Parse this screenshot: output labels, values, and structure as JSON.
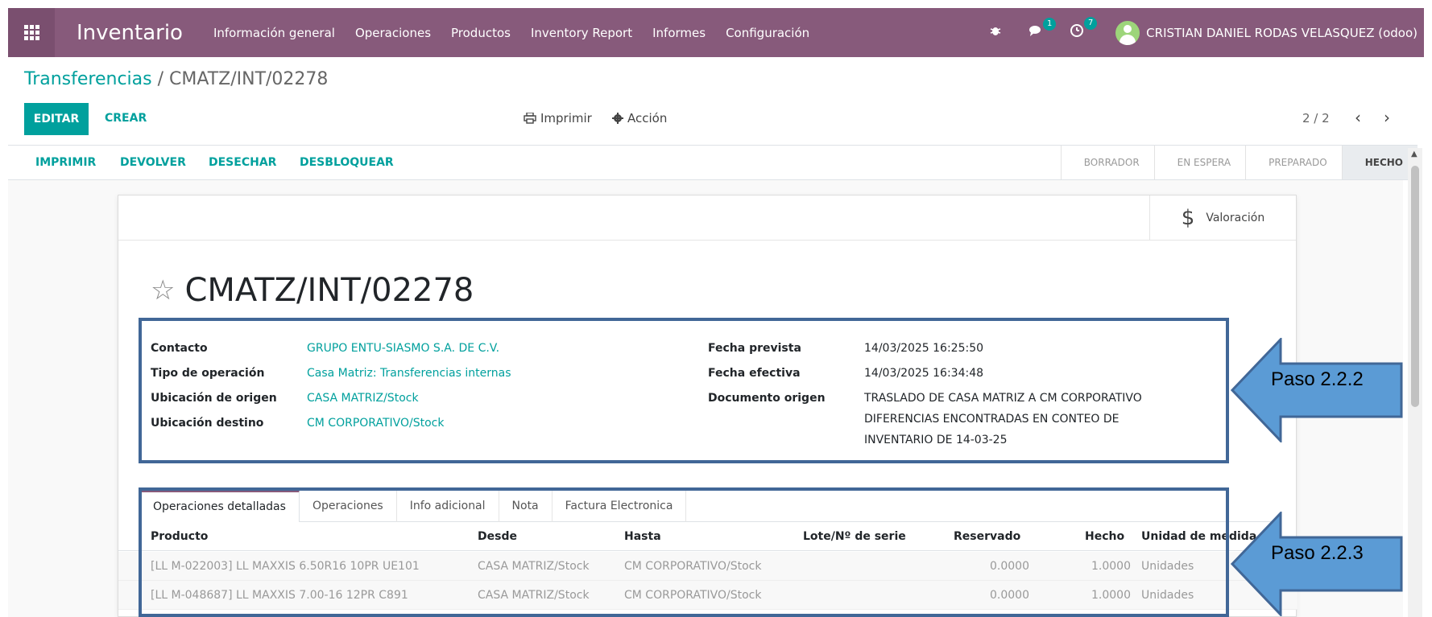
{
  "navbar": {
    "brand": "Inventario",
    "menu": [
      "Información general",
      "Operaciones",
      "Productos",
      "Inventory Report",
      "Informes",
      "Configuración"
    ],
    "messages_badge": "1",
    "activities_badge": "7",
    "user": "CRISTIAN DANIEL RODAS VELASQUEZ (odoo)"
  },
  "breadcrumb": {
    "parent": "Transferencias",
    "separator": " / ",
    "current": "CMATZ/INT/02278"
  },
  "control": {
    "edit_label": "EDITAR",
    "create_label": "CREAR",
    "print_label": "Imprimir",
    "action_label": "Acción",
    "pager": "2 / 2"
  },
  "statusbar": {
    "buttons": [
      "IMPRIMIR",
      "DEVOLVER",
      "DESECHAR",
      "DESBLOQUEAR"
    ],
    "stages": [
      "BORRADOR",
      "EN ESPERA",
      "PREPARADO",
      "HECHO"
    ],
    "active_stage": "HECHO"
  },
  "sheet": {
    "valoracion_label": "Valoración",
    "title": "CMATZ/INT/02278",
    "fields": {
      "contacto_label": "Contacto",
      "contacto": "GRUPO ENTU-SIASMO S.A. DE C.V.",
      "tipo_label": "Tipo de operación",
      "tipo": "Casa Matriz: Transferencias internas",
      "origen_label": "Ubicación de origen",
      "origen": "CASA MATRIZ/Stock",
      "destino_label": "Ubicación destino",
      "destino": "CM CORPORATIVO/Stock",
      "fecha_prevista_label": "Fecha prevista",
      "fecha_prevista": "14/03/2025 16:25:50",
      "fecha_efectiva_label": "Fecha efectiva",
      "fecha_efectiva": "14/03/2025 16:34:48",
      "documento_label": "Documento origen",
      "documento_line1": "TRASLADO DE CASA MATRIZ A CM CORPORATIVO",
      "documento_line2": "DIFERENCIAS ENCONTRADAS EN CONTEO DE",
      "documento_line3": "INVENTARIO DE 14-03-25"
    },
    "tabs": [
      "Operaciones detalladas",
      "Operaciones",
      "Info adicional",
      "Nota",
      "Factura Electronica"
    ],
    "table": {
      "headers": [
        "Producto",
        "Desde",
        "Hasta",
        "Lote/Nº de serie",
        "Reservado",
        "Hecho",
        "Unidad de medida"
      ],
      "rows": [
        [
          "[LL M-022003] LL MAXXIS 6.50R16 10PR UE101",
          "CASA MATRIZ/Stock",
          "CM CORPORATIVO/Stock",
          "",
          "0.0000",
          "1.0000",
          "Unidades"
        ],
        [
          "[LL M-048687] LL MAXXIS 7.00-16 12PR C891",
          "CASA MATRIZ/Stock",
          "CM CORPORATIVO/Stock",
          "",
          "0.0000",
          "1.0000",
          "Unidades"
        ]
      ]
    }
  },
  "annotations": {
    "step1": "Paso 2.2.2",
    "step2": "Paso 2.2.3"
  },
  "colors": {
    "navbar": "#875a7b",
    "accent": "#00a09d",
    "annotation": "#416797",
    "arrow_fill": "#5b9bd5"
  }
}
